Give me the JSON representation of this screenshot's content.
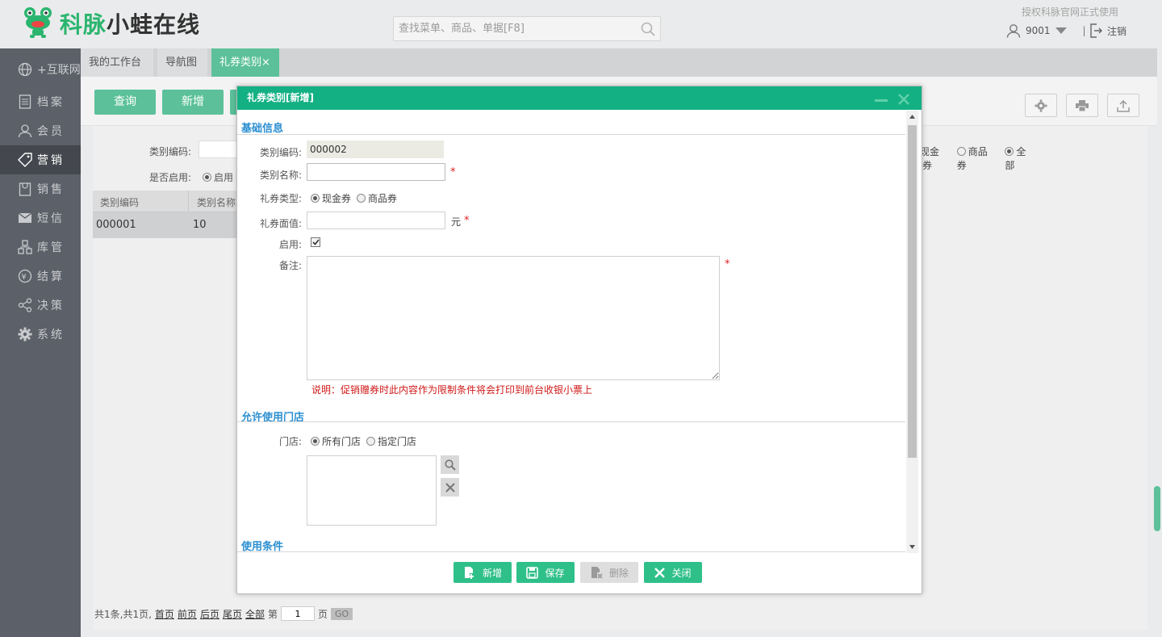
{
  "header": {
    "logo_brand": "科脉",
    "logo_rest": "小蛙在线",
    "search_placeholder": "查找菜单、商品、单据[F8]",
    "auth_text": "授权科脉官网正式使用",
    "user_id": "9001",
    "logout_label": "注销"
  },
  "sidebar": {
    "items": [
      {
        "label": "+互联网",
        "icon": "globe-icon"
      },
      {
        "label": "档案",
        "icon": "document-icon"
      },
      {
        "label": "会员",
        "icon": "person-icon"
      },
      {
        "label": "营销",
        "icon": "tag-icon"
      },
      {
        "label": "销售",
        "icon": "bag-icon"
      },
      {
        "label": "短信",
        "icon": "mail-icon"
      },
      {
        "label": "库管",
        "icon": "boxes-icon"
      },
      {
        "label": "结算",
        "icon": "yen-icon"
      },
      {
        "label": "决策",
        "icon": "share-icon"
      },
      {
        "label": "系统",
        "icon": "gear-icon"
      }
    ]
  },
  "tabs": [
    {
      "label": "我的工作台"
    },
    {
      "label": "导航图"
    },
    {
      "label": "礼券类别",
      "close": "×"
    }
  ],
  "toolbar": {
    "query_label": "查询",
    "add_label": "新增"
  },
  "filters": {
    "code_label": "类别编码:",
    "enabled_label": "是否启用:",
    "enabled_option": "启用",
    "type_options": [
      "现金券",
      "商品券",
      "全部"
    ]
  },
  "grid": {
    "columns": [
      "类别编码",
      "类别名称"
    ],
    "rows": [
      [
        "000001",
        "10"
      ]
    ]
  },
  "pager": {
    "summary": "共1条,共1页,",
    "first": "首页",
    "prev": "前页",
    "next": "后页",
    "last": "尾页",
    "all": "全部",
    "page_prefix": "第",
    "page_value": "1",
    "page_suffix": "页",
    "go": "GO"
  },
  "modal": {
    "title": "礼券类别[新增]",
    "section_basic": "基础信息",
    "code_label": "类别编码:",
    "code_value": "000002",
    "name_label": "类别名称:",
    "name_value": "",
    "type_label": "礼券类型:",
    "type_options": [
      "现金券",
      "商品券"
    ],
    "face_label": "礼券面值:",
    "face_unit": "元",
    "face_value": "",
    "enabled_label": "启用:",
    "remark_label": "备注:",
    "remark_note": "说明：促销赠券时此内容作为限制条件将会打印到前台收银小票上",
    "required_mark": "*",
    "section_store": "允许使用门店",
    "store_label": "门店:",
    "store_options": [
      "所有门店",
      "指定门店"
    ],
    "section_condition": "使用条件",
    "buttons": {
      "add": "新增",
      "save": "保存",
      "delete": "删除",
      "close": "关闭"
    }
  },
  "colors": {
    "accent": "#5cc19a",
    "modal_header": "#13b083",
    "sidebar": "#5c6068",
    "section_title": "#2c8fd1",
    "note": "#d01818"
  }
}
